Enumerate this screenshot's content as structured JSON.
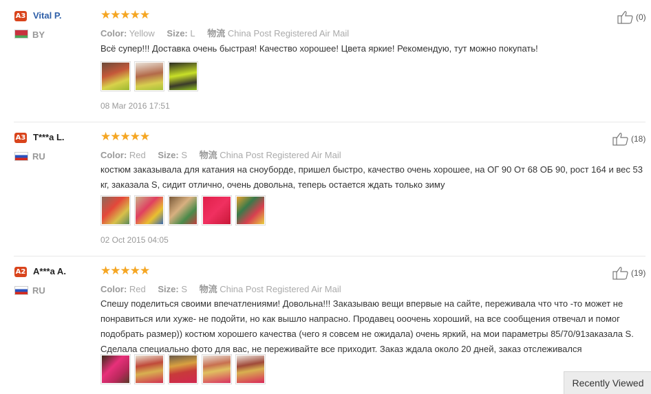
{
  "reviews": [
    {
      "level": "A3",
      "name": "Vital P.",
      "country": "BY",
      "stars": "★★★★★",
      "color_label": "Color:",
      "color": "Yellow",
      "size_label": "Size:",
      "size": "L",
      "shipping_label": "物流",
      "shipping": "China Post Registered Air Mail",
      "text": "Всё супер!!! Доставка очень быстрая! Качество хорошее! Цвета яркие! Рекомендую, тут можно покупать!",
      "photos": 3,
      "date": "08 Mar 2016 17:51",
      "likes": "(0)"
    },
    {
      "level": "A3",
      "name": "T***a L.",
      "country": "RU",
      "stars": "★★★★★",
      "color_label": "Color:",
      "color": "Red",
      "size_label": "Size:",
      "size": "S",
      "shipping_label": "物流",
      "shipping": "China Post Registered Air Mail",
      "text": "костюм заказывала для катания на сноуборде, пришел быстро, качество очень хорошее, на ОГ 90 От 68 ОБ 90, рост 164 и вес 53 кг, заказала S, сидит отлично, очень довольна, теперь остается ждать только зиму",
      "photos": 5,
      "date": "02 Oct 2015 04:05",
      "likes": "(18)"
    },
    {
      "level": "A2",
      "name": "A***a A.",
      "country": "RU",
      "stars": "★★★★★",
      "color_label": "Color:",
      "color": "Red",
      "size_label": "Size:",
      "size": "S",
      "shipping_label": "物流",
      "shipping": "China Post Registered Air Mail",
      "text": "Спешу поделиться своими впечатлениями! Довольна!!! Заказываю вещи впервые на сайте, переживала что что -то может не понравиться или хуже- не подойти, но как вышло напрасно. Продавец ооочень хороший, на все сообщения отвечал и помог подобрать размер)) костюм хорошего качества (чего я совсем не ожидала) очень яркий, на мои параметры 85/70/91заказала S. Сделала специально фото для вас, не переживайте все приходит. Заказ ждала около 20 дней, заказ отслеживался",
      "photos": 5,
      "likes": "(19)"
    }
  ],
  "recently_viewed": "Recently Viewed",
  "colors": {
    "badge": "#d9441c",
    "star": "#f5a623",
    "name_blue": "#2e5fa8"
  }
}
